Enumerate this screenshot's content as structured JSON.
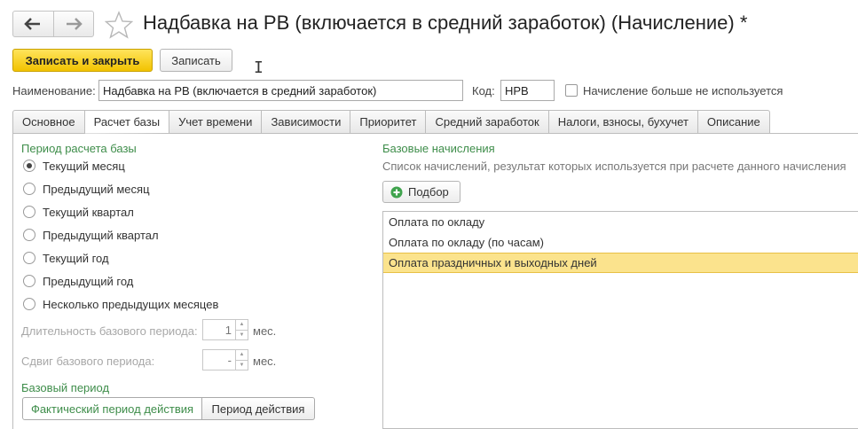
{
  "window": {
    "title": "Надбавка на РВ (включается в средний заработок) (Начисление) *",
    "nav_back_icon": "arrow-left-icon",
    "nav_forward_icon": "arrow-right-icon",
    "favorite_icon": "star-icon"
  },
  "toolbar": {
    "save_close_label": "Записать и закрыть",
    "save_label": "Записать"
  },
  "fields": {
    "name_label": "Наименование:",
    "name_value": "Надбавка на РВ (включается в средний заработок)",
    "code_label": "Код:",
    "code_value": "НРВ",
    "unused_label": "Начисление больше не используется",
    "unused_checked": false
  },
  "tabs": [
    {
      "label": "Основное"
    },
    {
      "label": "Расчет базы"
    },
    {
      "label": "Учет времени"
    },
    {
      "label": "Зависимости"
    },
    {
      "label": "Приоритет"
    },
    {
      "label": "Средний заработок"
    },
    {
      "label": "Налоги, взносы, бухучет"
    },
    {
      "label": "Описание"
    }
  ],
  "active_tab": "Расчет базы",
  "base_period": {
    "title": "Период расчета базы",
    "options": [
      {
        "label": "Текущий месяц",
        "selected": true
      },
      {
        "label": "Предыдущий месяц",
        "selected": false
      },
      {
        "label": "Текущий квартал",
        "selected": false
      },
      {
        "label": "Предыдущий квартал",
        "selected": false
      },
      {
        "label": "Текущий год",
        "selected": false
      },
      {
        "label": "Предыдущий год",
        "selected": false
      },
      {
        "label": "Несколько предыдущих месяцев",
        "selected": false
      }
    ],
    "duration_label": "Длительность базового периода:",
    "duration_value": "1",
    "duration_unit": "мес.",
    "shift_label": "Сдвиг базового периода:",
    "shift_value": "-",
    "shift_unit": "мес."
  },
  "base_period_mode": {
    "title": "Базовый период",
    "option_actual": "Фактический период действия",
    "option_period": "Период действия"
  },
  "base_accruals": {
    "title": "Базовые начисления",
    "description": "Список начислений, результат которых используется при расчете данного начисления",
    "pick_label": "Подбор",
    "pick_icon": "plus-circle-icon",
    "rows": [
      {
        "name": "Оплата по окладу"
      },
      {
        "name": "Оплата по окладу (по часам)"
      },
      {
        "name": "Оплата праздничных и выходных дней"
      }
    ],
    "selected_row": 2
  },
  "colors": {
    "accent_green": "#3e8d4a",
    "primary_yellow": "#f2c300",
    "selection": "#fbe38d"
  }
}
